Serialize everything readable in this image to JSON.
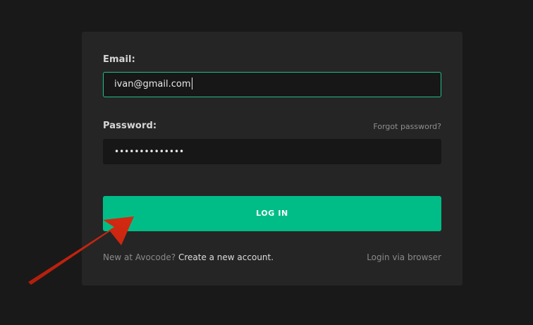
{
  "form": {
    "email_label": "Email:",
    "email_value": "ivan@gmail.com",
    "password_label": "Password:",
    "forgot_password": "Forgot password?",
    "password_value": "••••••••••••••",
    "login_button": "LOG IN",
    "new_prompt": "New at Avocode?",
    "create_account": "Create a new account.",
    "login_browser": "Login via browser"
  },
  "colors": {
    "accent": "#00bd87",
    "focus_border": "#1fbf8a",
    "arrow": "#c8230f",
    "card_bg": "#252525",
    "page_bg": "#191919"
  }
}
